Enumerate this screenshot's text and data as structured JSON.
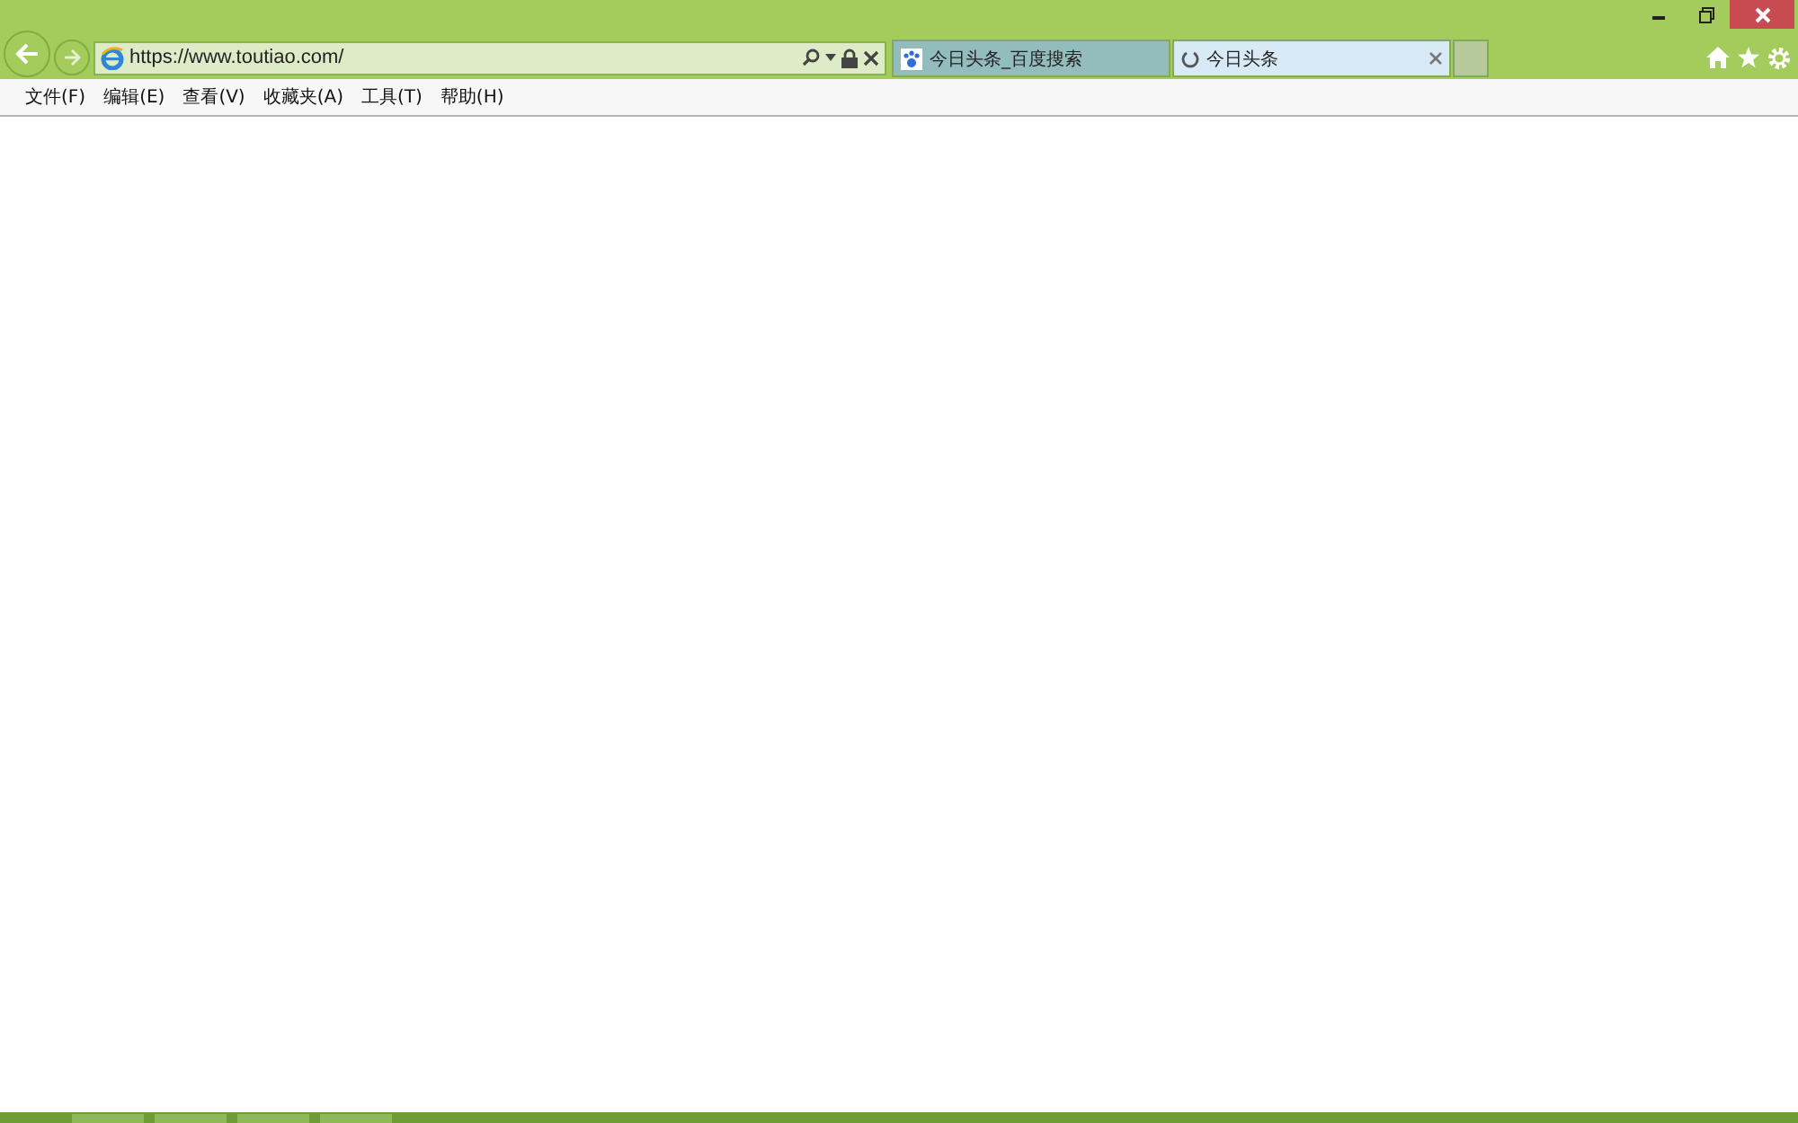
{
  "address_bar": {
    "url": "https://www.toutiao.com/"
  },
  "tabs": [
    {
      "title": "今日头条_百度搜索",
      "selected": false,
      "kind": "favicon"
    },
    {
      "title": "今日头条",
      "selected": true,
      "kind": "loading"
    }
  ],
  "menu_bar": [
    "文件(F)",
    "编辑(E)",
    "查看(V)",
    "收藏夹(A)",
    "工具(T)",
    "帮助(H)"
  ]
}
